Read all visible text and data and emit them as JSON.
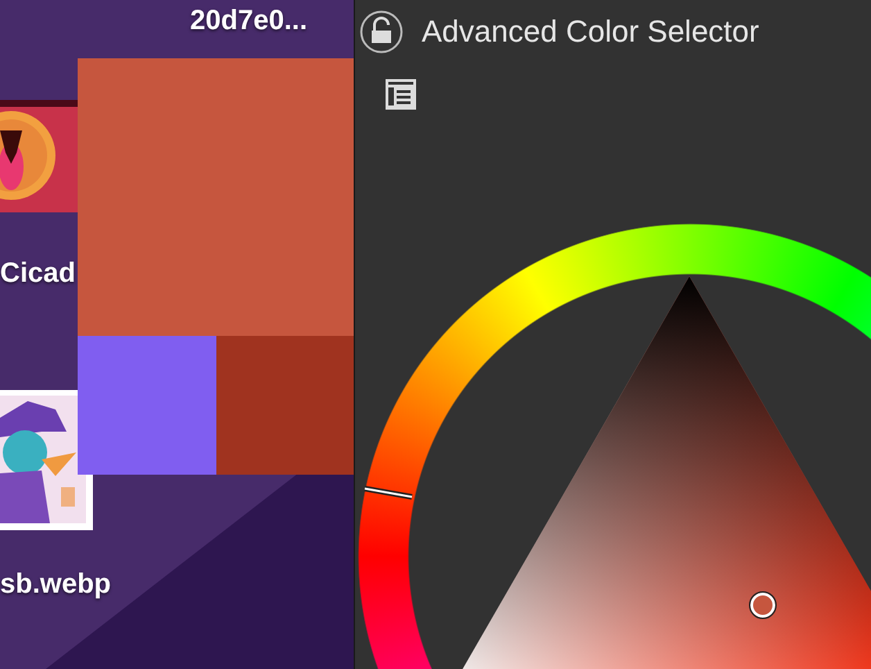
{
  "desktop": {
    "files": [
      {
        "label": "20d7e0...",
        "kind": "none"
      },
      {
        "label": "Cicad",
        "kind": "app"
      },
      {
        "label": "sb.webp",
        "kind": "image"
      }
    ]
  },
  "swatches": [
    {
      "color": "#c6563e"
    },
    {
      "color": "#805ef0"
    },
    {
      "color": "#a0331f"
    }
  ],
  "docker": {
    "title": "Advanced Color Selector",
    "locked": false
  }
}
